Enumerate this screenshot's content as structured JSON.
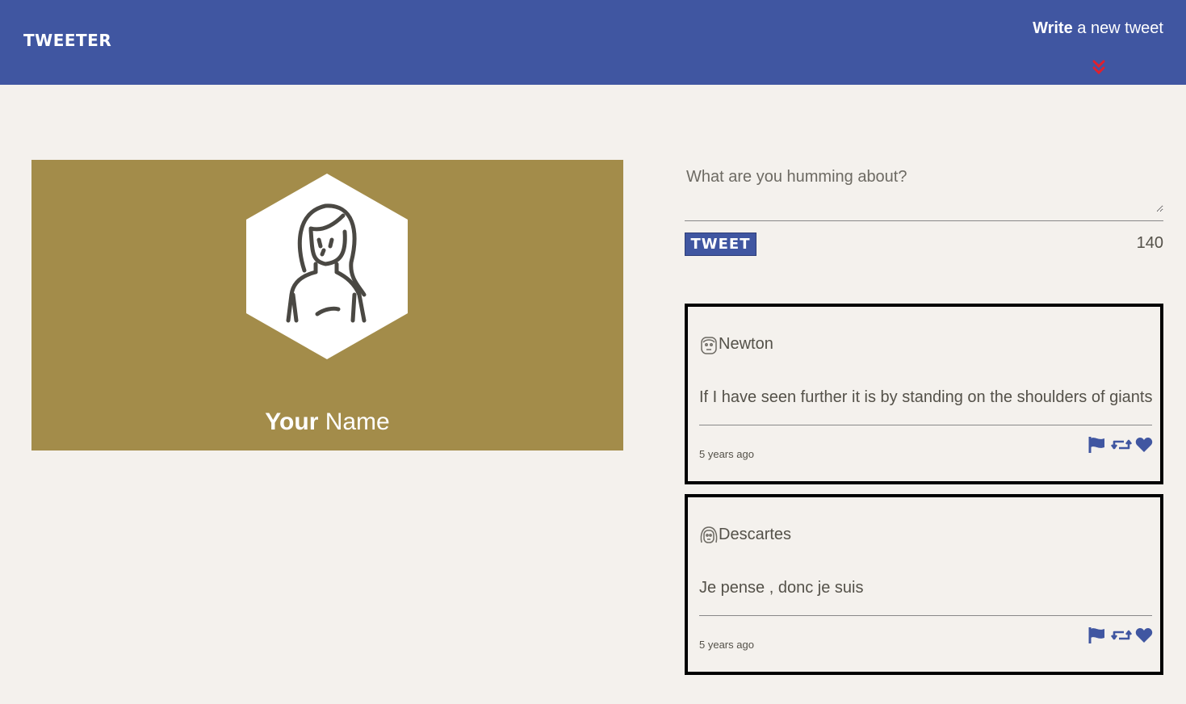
{
  "nav": {
    "brand": "TWEETER",
    "compose_bold": "Write",
    "compose_rest": " a new tweet",
    "compose_icon": "double-chevron-down-icon",
    "brand_color": "#4056a1",
    "accent_color": "#e0202e"
  },
  "profile": {
    "name_bold": "Your",
    "name_rest": " Name",
    "background_color": "#a38c4a",
    "avatar_icon": "woman-avatar-icon"
  },
  "compose": {
    "placeholder": "What are you humming about?",
    "button_label": "TWEET",
    "counter": "140"
  },
  "tweets": [
    {
      "author": "Newton",
      "body": "If I have seen further it is by standing on the shoulders of giants",
      "time": "5 years ago",
      "actions": [
        "flag-icon",
        "retweet-icon",
        "heart-icon"
      ]
    },
    {
      "author": "Descartes",
      "body": "Je pense , donc je suis",
      "time": "5 years ago",
      "actions": [
        "flag-icon",
        "retweet-icon",
        "heart-icon"
      ]
    }
  ]
}
